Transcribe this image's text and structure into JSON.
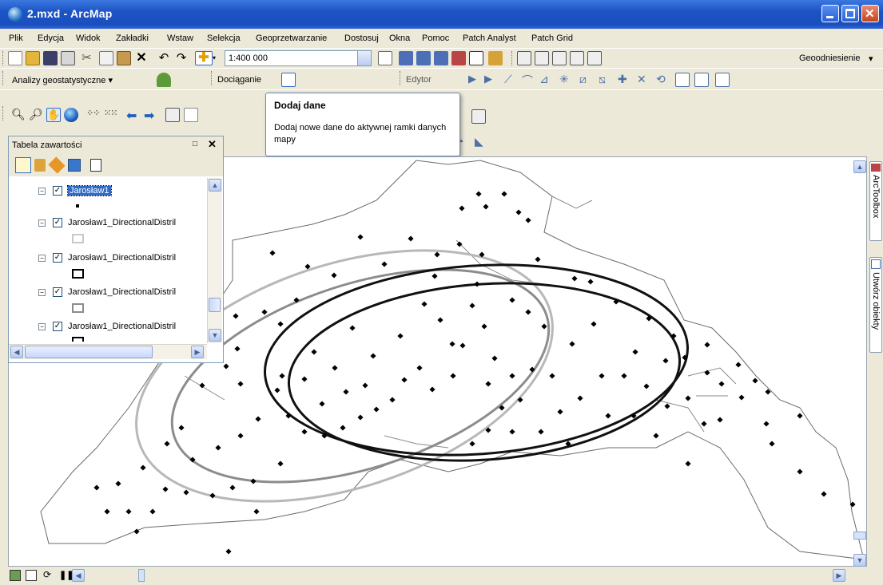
{
  "window": {
    "title": "2.mxd - ArcMap"
  },
  "menu": [
    "Plik",
    "Edycja",
    "Widok",
    "Zakładki",
    "Wstaw",
    "Selekcja",
    "Geoprzetwarzanie",
    "Dostosuj",
    "Okna",
    "Pomoc",
    "Patch Analyst",
    "Patch Grid"
  ],
  "toolbar": {
    "scale": "1:400 000",
    "georef_label": "Geoodniesienie",
    "geostat_label": "Analizy geostatystyczne",
    "snapping_label": "Dociąganie",
    "editor_label": "Edytor"
  },
  "tooltip": {
    "title": "Dodaj dane",
    "body": "Dodaj nowe dane do aktywnej ramki danych mapy"
  },
  "toc": {
    "title": "Tabela zawartości",
    "layers": [
      {
        "name": "Jarosław1",
        "checked": true,
        "symbol": "point",
        "selected": true
      },
      {
        "name": "Jarosław1_DirectionalDistril",
        "checked": true,
        "symbol": "rect-light"
      },
      {
        "name": "Jarosław1_DirectionalDistril",
        "checked": true,
        "symbol": "rect-black"
      },
      {
        "name": "Jarosław1_DirectionalDistril",
        "checked": true,
        "symbol": "rect-gray"
      },
      {
        "name": "Jarosław1_DirectionalDistril",
        "checked": true,
        "symbol": "rect-black"
      }
    ]
  },
  "dock": {
    "toolbox": "ArcToolbox",
    "create": "Utwórz obiekty"
  },
  "colors": {
    "title_bar": "#1d53c4",
    "ellipse_light": "#b8b8b8",
    "ellipse_gray": "#8c8c8c",
    "ellipse_black": "#111111",
    "selection": "#316ac5"
  }
}
